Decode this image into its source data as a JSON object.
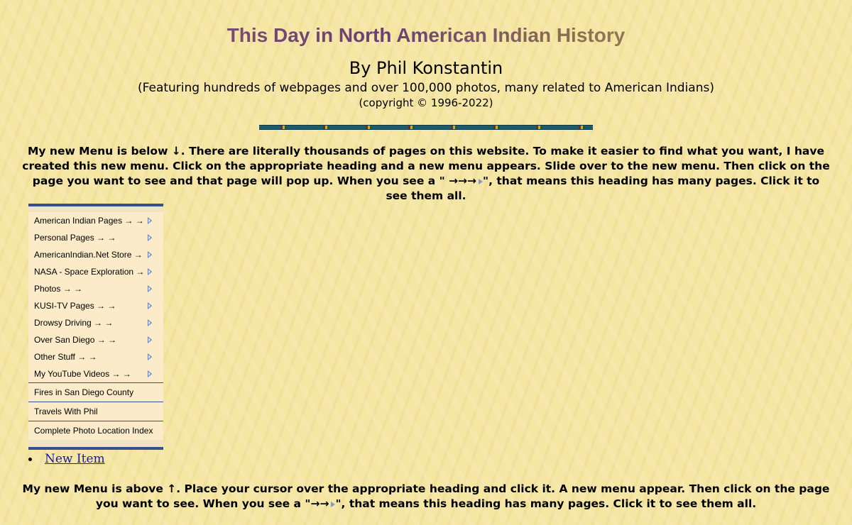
{
  "header": {
    "title": "This Day in North American Indian History",
    "byline": "By Phil Konstantin",
    "featuring": "(Featuring hundreds of webpages and over 100,000 photos, many related to American Indians)",
    "copyright": "(copyright © 1996-2022)"
  },
  "intro": {
    "text": "My new Menu is below ↓. There are literally thousands of pages on this website. To make it easier to find what you want, I have created this new menu. Click on the appropriate heading and a new menu appears. Slide over to the new menu. Then click on the page you want to see and that page will pop up. When you see a \" →→→",
    "text_end": "\", that means this heading has many pages. Click it to see them all."
  },
  "menu": {
    "submenus": [
      {
        "label": "American Indian Pages → →"
      },
      {
        "label": "Personal Pages → →"
      },
      {
        "label": "AmericanIndian.Net Store →"
      },
      {
        "label": "NASA - Space Exploration →"
      },
      {
        "label": "Photos → →"
      },
      {
        "label": "KUSI-TV Pages → →"
      },
      {
        "label": "Drowsy Driving → →"
      },
      {
        "label": "Over San Diego → →"
      },
      {
        "label": "Other Stuff → →"
      },
      {
        "label": "My YouTube Videos → →"
      }
    ],
    "links": [
      {
        "label": "Fires in San Diego County"
      },
      {
        "label": "Travels With Phil"
      },
      {
        "label": "Complete Photo Location Index"
      }
    ]
  },
  "list": {
    "new_item": "New Item"
  },
  "outro": {
    "text": "My new Menu is above ↑. Place your cursor over the appropriate heading and click it. A new menu appear. Then click on the page you want to see. When you see a \"→→",
    "text_end": "\", that means this heading has many pages. Click it to see them all."
  },
  "colors": {
    "background": "#f5e6a3",
    "menu_bg": "#fbebc8",
    "menu_border": "#34508f",
    "link": "#1a1aa8",
    "submenu_arrow": "#5a7fd0"
  }
}
